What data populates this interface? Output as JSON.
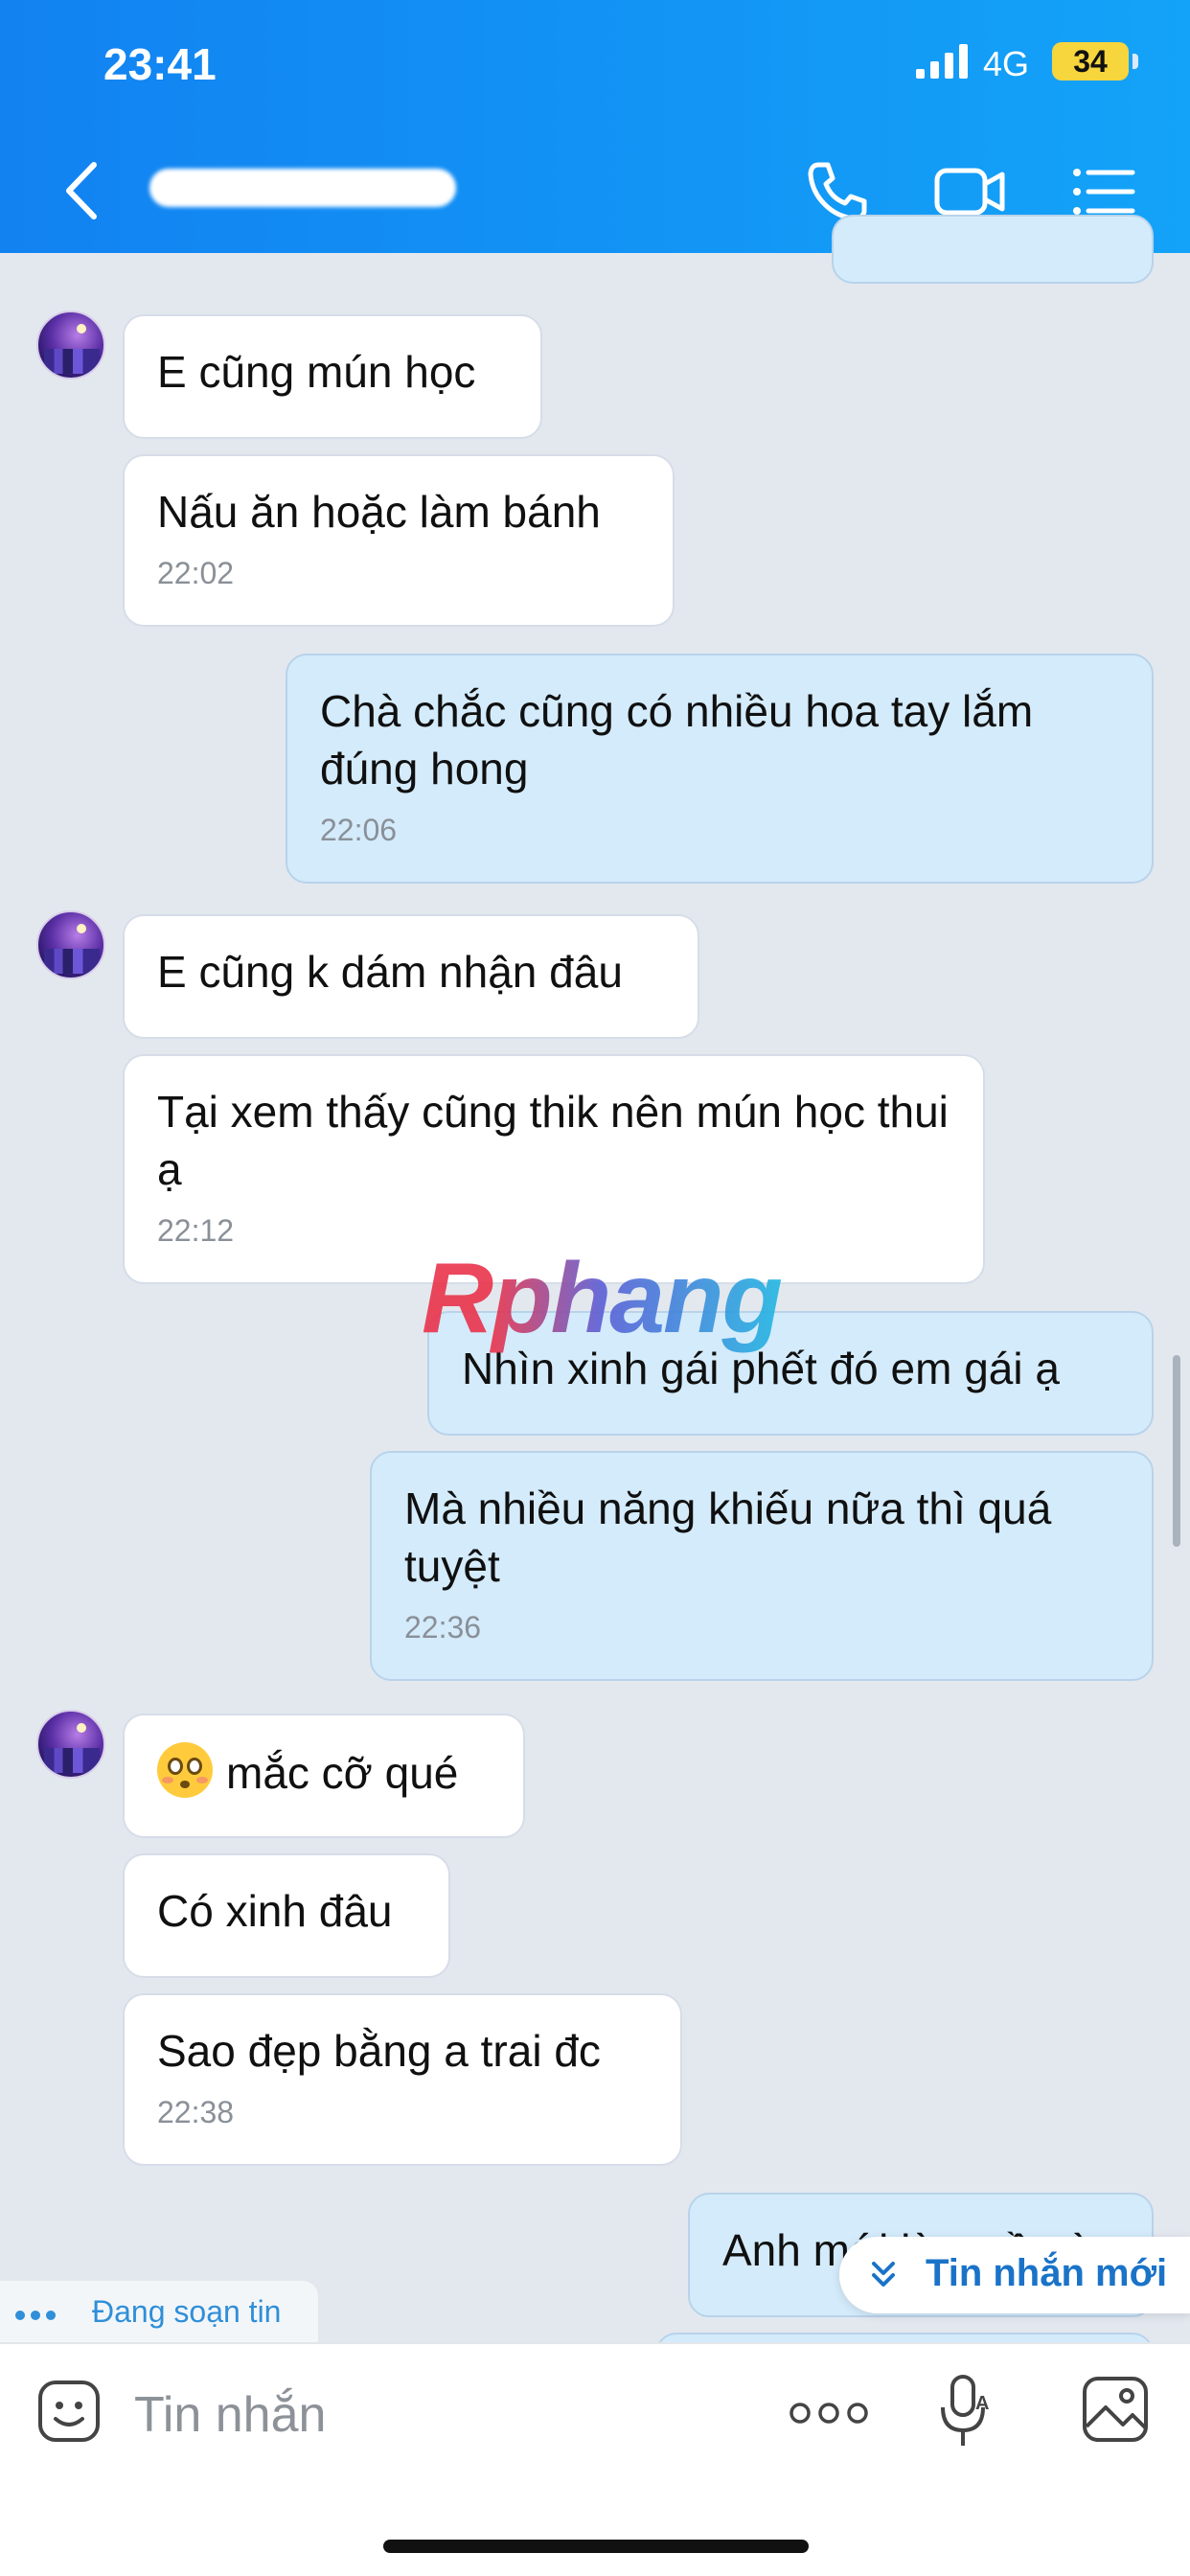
{
  "status_bar": {
    "time": "23:41",
    "network": "4G",
    "battery": "34"
  },
  "header": {
    "contact_name": "T",
    "call_icon": "phone-icon",
    "video_icon": "video-call-icon",
    "menu_icon": "list-menu-icon"
  },
  "messages": [
    {
      "dir": "in",
      "text": "E cũng mún học"
    },
    {
      "dir": "in",
      "text": "Nấu ăn hoặc làm bánh",
      "time": "22:02"
    },
    {
      "dir": "out",
      "text": "Chà chắc cũng có nhiều hoa tay lắm đúng hong",
      "time": "22:06"
    },
    {
      "dir": "in",
      "text": "E cũng k dám nhận đâu"
    },
    {
      "dir": "in",
      "text": "Tại xem thấy cũng thik nên mún học thui ạ",
      "time": "22:12"
    },
    {
      "dir": "out",
      "text": "Nhìn xinh gái phết đó em gái ạ"
    },
    {
      "dir": "out",
      "text": "Mà nhiều năng khiếu nữa thì quá tuyệt",
      "time": "22:36"
    },
    {
      "dir": "in",
      "text": "mắc cỡ qué",
      "emoji": "flushed-face-icon"
    },
    {
      "dir": "in",
      "text": "Có xinh đâu"
    },
    {
      "dir": "in",
      "text": "Sao đẹp bằng a trai đc",
      "time": "22:38"
    },
    {
      "dir": "out",
      "text": "Anh mới làm về nè"
    }
  ],
  "watermark": "Rphang",
  "typing_indicator": "Đang soạn tin",
  "new_message_button": "Tin nhắn mới",
  "composer": {
    "placeholder": "Tin nhắn",
    "sticker_icon": "sticker-icon",
    "more_icon": "more-options-icon",
    "voice_icon": "voice-to-text-icon",
    "image_icon": "image-gallery-icon"
  },
  "colors": {
    "header_start": "#1282f1",
    "header_end": "#13a3f8",
    "incoming_bubble": "#ffffff",
    "outgoing_bubble": "#d4ebfb",
    "chat_bg": "#e3e8ef",
    "accent": "#1a73c8"
  }
}
